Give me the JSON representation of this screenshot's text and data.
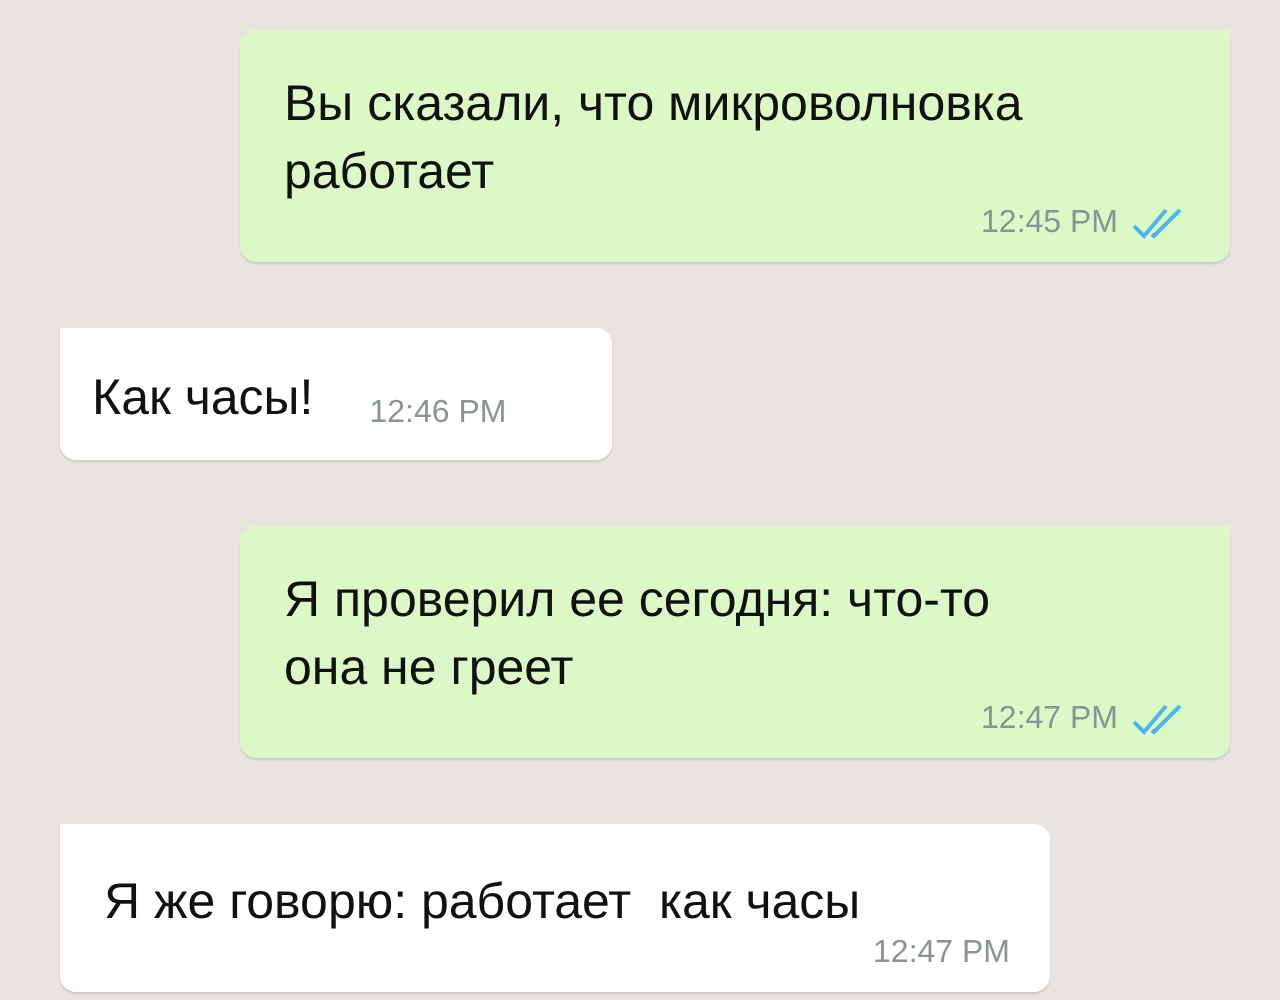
{
  "messages": [
    {
      "kind": "outgoing",
      "text": "Вы сказали, что микроволновка работает",
      "time": "12:45 PM",
      "read": true
    },
    {
      "kind": "incoming",
      "text": "Как часы!",
      "time": "12:46 PM"
    },
    {
      "kind": "outgoing",
      "text": "Я проверил ее сегодня: что-то она не греет",
      "time": "12:47 PM",
      "read": true
    },
    {
      "kind": "incoming",
      "text": "Я же говорю: работает  как часы",
      "time": "12:47 PM"
    }
  ]
}
